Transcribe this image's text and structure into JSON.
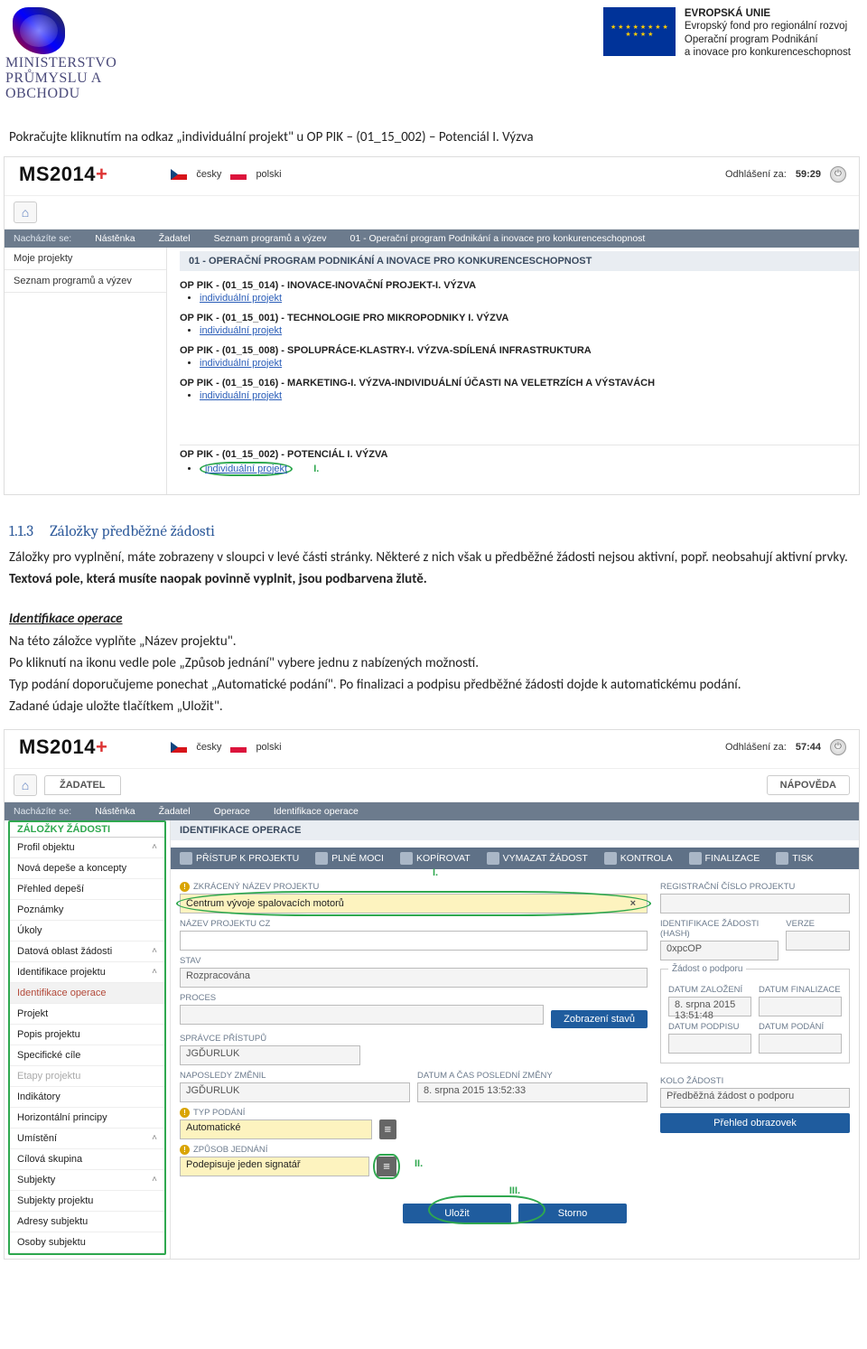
{
  "doc_header": {
    "mpo_line1": "MINISTERSTVO",
    "mpo_line2": "PRŮMYSLU A OBCHODU",
    "eu_line1": "EVROPSKÁ UNIE",
    "eu_line2": "Evropský fond pro regionální rozvoj",
    "eu_line3": "Operační program Podnikání",
    "eu_line4": "a inovace pro konkurenceschopnost"
  },
  "narrative": {
    "lead": "Pokračujte kliknutím na odkaz „individuální projekt\" u OP PIK – (01_15_002) – Potenciál I. Výzva",
    "h3_num": "1.1.3",
    "h3_txt": "Záložky předběžné žádosti",
    "p1": "Záložky pro vyplnění, máte zobrazeny v sloupci v levé části stránky. Některé z nich však u předběžné žádosti nejsou aktivní, popř. neobsahují aktivní prvky.",
    "p2": "Textová pole, která musíte naopak povinně vyplnit, jsou podbarvena žlutě.",
    "p3_t": "Identifikace operace",
    "p3": "Na této záložce vyplňte „Název projektu\".",
    "p4": "Po kliknutí na ikonu vedle pole „Způsob jednání\" vybere jednu z nabízených možností.",
    "p5": "Typ podání doporučujeme ponechat „Automatické podání\". Po finalizaci a podpisu předběžné žádosti dojde k automatickému podání.",
    "p6": "Zadané údaje uložte tlačítkem „Uložit\"."
  },
  "shot1": {
    "logo": "MS2014",
    "lang_cz": "česky",
    "lang_pl": "polski",
    "logoff_label": "Odhlášení za:",
    "logoff_value": "59:29",
    "crumbs_label": "Nacházíte se:",
    "crumbs": [
      "Nástěnka",
      "Žadatel",
      "Seznam programů a výzev",
      "01 - Operační program Podnikání a inovace pro konkurenceschopnost"
    ],
    "left_items": [
      "Moje projekty",
      "Seznam programů a výzev"
    ],
    "section_title": "01 - OPERAČNÍ PROGRAM PODNIKÁNÍ A INOVACE PRO KONKURENCESCHOPNOST",
    "ops": [
      {
        "h": "OP PIK - (01_15_014) - INOVACE-INOVAČNÍ PROJEKT-I. VÝZVA",
        "link": "individuální projekt"
      },
      {
        "h": "OP PIK - (01_15_001) - TECHNOLOGIE PRO MIKROPODNIKY I. VÝZVA",
        "link": "individuální projekt"
      },
      {
        "h": "OP PIK - (01_15_008) - SPOLUPRÁCE-KLASTRY-I. VÝZVA-SDÍLENÁ INFRASTRUKTURA",
        "link": "individuální projekt"
      },
      {
        "h": "OP PIK - (01_15_016) - MARKETING-I. VÝZVA-INDIVIDUÁLNÍ ÚČASTI NA VELETRZÍCH A VÝSTAVÁCH",
        "link": "individuální projekt"
      }
    ],
    "op_last": {
      "h": "OP PIK - (01_15_002) - POTENCIÁL I. VÝZVA",
      "link": "individuální projekt"
    },
    "roman": "I."
  },
  "shot2": {
    "logo": "MS2014",
    "lang_cz": "česky",
    "lang_pl": "polski",
    "logoff_label": "Odhlášení za:",
    "logoff_value": "57:44",
    "tab": "ŽADATEL",
    "help": "NÁPOVĚDA",
    "crumbs_label": "Nacházíte se:",
    "crumbs": [
      "Nástěnka",
      "Žadatel",
      "Operace",
      "Identifikace operace"
    ],
    "zal_head": "ZÁLOŽKY ŽÁDOSTI",
    "side": {
      "profil": "Profil objektu",
      "items1": [
        "Nová depeše a koncepty",
        "Přehled depeší",
        "Poznámky",
        "Úkoly"
      ],
      "dat": "Datová oblast žádosti",
      "ident_grp": "Identifikace projektu",
      "ident_op": "Identifikace operace",
      "items2": [
        "Projekt",
        "Popis projektu",
        "Specifické cíle"
      ],
      "dim": "Etapy projektu",
      "items3": [
        "Indikátory",
        "Horizontální principy"
      ],
      "umist": "Umístění",
      "cil": "Cílová skupina",
      "subj": "Subjekty",
      "items4": [
        "Subjekty projektu",
        "Adresy subjektu",
        "Osoby subjektu"
      ]
    },
    "panel_title": "IDENTIFIKACE OPERACE",
    "toolbar": [
      "PŘÍSTUP K PROJEKTU",
      "PLNÉ MOCI",
      "KOPÍROVAT",
      "VYMAZAT ŽÁDOST",
      "KONTROLA",
      "FINALIZACE",
      "TISK"
    ],
    "labels": {
      "zkr": "ZKRÁCENÝ NÁZEV PROJEKTU",
      "nazev": "NÁZEV PROJEKTU CZ",
      "stav": "STAV",
      "proces": "PROCES",
      "spravce": "SPRÁVCE PŘÍSTUPŮ",
      "naposledy_kdo": "NAPOSLEDY ZMĚNIL",
      "naposledy_kdy": "DATUM A ČAS POSLEDNÍ ZMĚNY",
      "typ_podani": "TYP PODÁNÍ",
      "zpusob": "ZPŮSOB JEDNÁNÍ",
      "reg": "REGISTRAČNÍ ČÍSLO PROJEKTU",
      "hash": "IDENTIFIKACE ŽÁDOSTI (HASH)",
      "verze": "VERZE",
      "fieldset": "Žádost o podporu",
      "dzal": "DATUM ZALOŽENÍ",
      "dfin": "DATUM FINALIZACE",
      "dpod1": "DATUM PODPISU",
      "dpod2": "DATUM PODÁNÍ",
      "kolo": "KOLO ŽÁDOSTI"
    },
    "values": {
      "zkr": "Centrum vývoje spalovacích motorů",
      "stav": "Rozpracována",
      "spravce": "JGĎURLUK",
      "naposledy_kdo": "JGĎURLUK",
      "naposledy_kdy": "8. srpna 2015 13:52:33",
      "typ_podani": "Automatické",
      "zpusob": "Podepisuje jeden signatář",
      "hash": "0xpcOP",
      "dzal": "8. srpna 2015 13:51:48",
      "kolo": "Předběžná žádost o podporu"
    },
    "btns": {
      "stavy": "Zobrazení stavů",
      "prehled": "Přehled obrazovek",
      "ulozit": "Uložit",
      "storno": "Storno"
    },
    "ann": {
      "i": "I.",
      "ii": "II.",
      "iii": "III."
    }
  }
}
